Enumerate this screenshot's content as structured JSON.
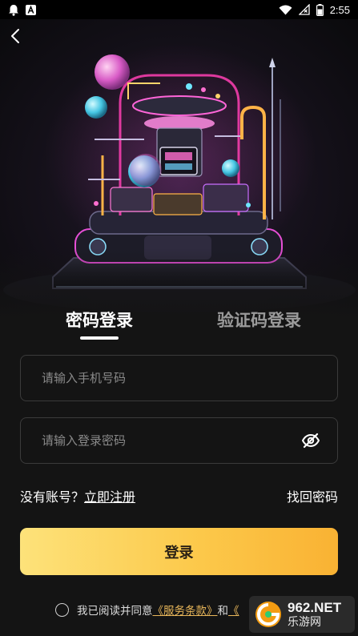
{
  "status_bar": {
    "time": "2:55",
    "left_icons": [
      "notification-bell-icon",
      "app-a-icon"
    ],
    "right_icons": [
      "wifi-icon",
      "no-signal-icon",
      "battery-icon"
    ]
  },
  "header": {
    "back_icon": "back-arrow-icon"
  },
  "tabs": [
    {
      "label": "密码登录",
      "active": true
    },
    {
      "label": "验证码登录",
      "active": false
    }
  ],
  "form": {
    "phone_placeholder": "请输入手机号码",
    "phone_value": "",
    "password_placeholder": "请输入登录密码",
    "password_value": "",
    "password_toggle_icon": "eye-off-icon"
  },
  "links": {
    "no_account": "没有账号？",
    "register": "立即注册",
    "forgot_password": "找回密码"
  },
  "login_button_label": "登录",
  "agreement": {
    "prefix": "我已阅读并同意",
    "terms": "《服务条款》",
    "and": "和",
    "privacy_visible": "《"
  },
  "watermark": {
    "site": "962.NET",
    "name": "乐游网"
  },
  "colors": {
    "background": "#141414",
    "accent_gold": "#fcc94b",
    "link_gold": "#e9b75a",
    "field_border": "#3b3b3b",
    "placeholder": "#8a8a8a"
  }
}
